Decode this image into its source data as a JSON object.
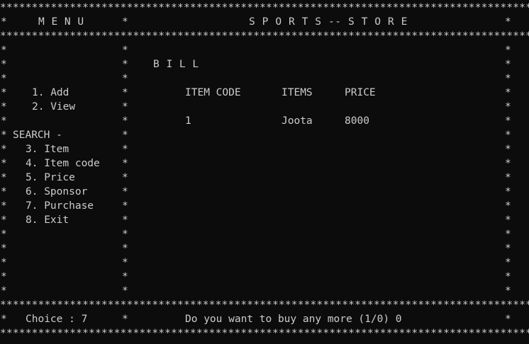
{
  "border_line": "****************************************************************************************",
  "header": {
    "menu_title": "M E N U",
    "store_title": "S P O R T S -- S T O R E"
  },
  "menu": {
    "add": "1. Add",
    "view": "2. View",
    "search_heading": "SEARCH -",
    "item": "3. Item",
    "item_code": "4. Item code",
    "price": "5. Price",
    "sponsor": "6. Sponsor",
    "purchase": "7. Purchase",
    "exit": "8. Exit"
  },
  "bill": {
    "title": "B I L L",
    "columns": [
      "ITEM CODE",
      "ITEMS",
      "PRICE"
    ],
    "rows": [
      {
        "code": "1",
        "item": "Joota",
        "price": "8000"
      }
    ]
  },
  "footer": {
    "choice": "Choice : 7",
    "prompt": "Do you want to buy any more (1/0) 0"
  },
  "star": "*"
}
